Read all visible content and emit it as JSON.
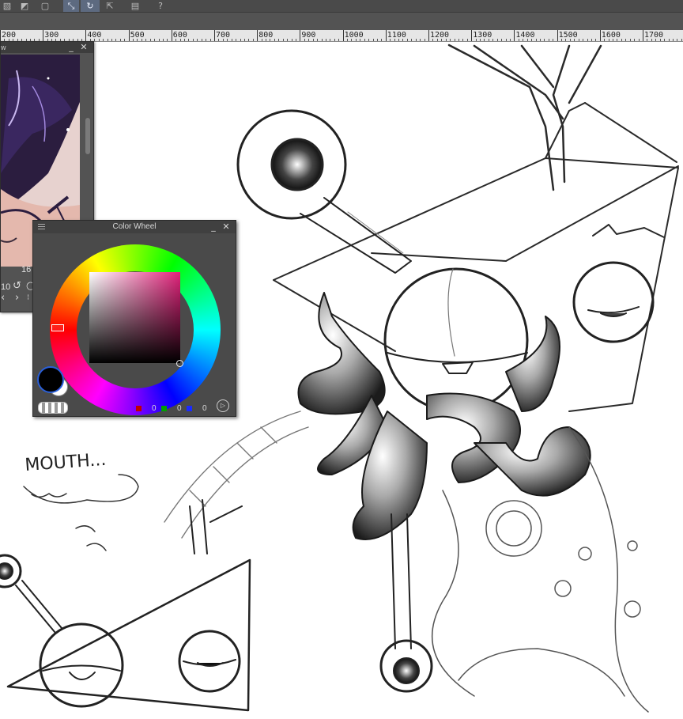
{
  "toolbar": {
    "icons": [
      "hatch-icon",
      "fill-icon",
      "square-icon",
      "lasso-icon",
      "brush-loop-icon",
      "export-icon",
      "clipboard-icon",
      "help-icon"
    ]
  },
  "ruler": {
    "labels": [
      "200",
      "300",
      "400",
      "500",
      "600",
      "700",
      "800",
      "900",
      "1000",
      "1100",
      "1200",
      "1300",
      "1400",
      "1500",
      "1600",
      "1700"
    ]
  },
  "navigator": {
    "title": "w",
    "minimize": "_",
    "close": "✕",
    "zoom_value": "10",
    "angle_value": "16",
    "rotate_icon": "↺",
    "prev_icon": "‹",
    "next_icon": "›"
  },
  "color_wheel": {
    "title": "Color Wheel",
    "minimize": "_",
    "close": "✕",
    "main_color": "#000000",
    "sub_color": "#ffffff",
    "hue_color": "#e0227a",
    "r": "0",
    "g": "0",
    "b": "0",
    "toggle_icon": "▷"
  },
  "canvas": {
    "sketch_text": "MOUTH..."
  }
}
